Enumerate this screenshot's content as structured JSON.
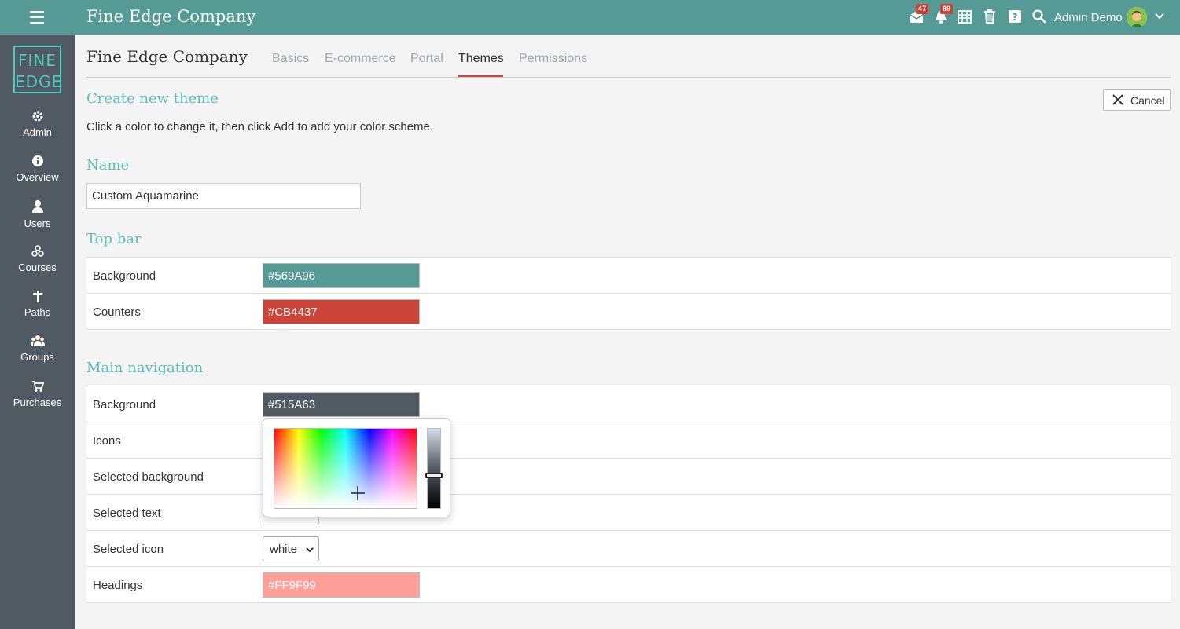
{
  "topbar": {
    "brand": "Fine Edge Company",
    "messages_count": "47",
    "notifications_count": "89",
    "user_name": "Admin Demo"
  },
  "sidebar": {
    "logo_line1": "FINE",
    "logo_line2": "EDGE",
    "items": [
      {
        "label": "Admin",
        "icon": "gear-icon"
      },
      {
        "label": "Overview",
        "icon": "info-icon"
      },
      {
        "label": "Users",
        "icon": "user-icon"
      },
      {
        "label": "Courses",
        "icon": "courses-icon"
      },
      {
        "label": "Paths",
        "icon": "signpost-icon"
      },
      {
        "label": "Groups",
        "icon": "group-icon"
      },
      {
        "label": "Purchases",
        "icon": "cart-icon"
      }
    ]
  },
  "page": {
    "title": "Fine Edge Company",
    "tabs": [
      {
        "label": "Basics"
      },
      {
        "label": "E-commerce"
      },
      {
        "label": "Portal"
      },
      {
        "label": "Themes",
        "active": true
      },
      {
        "label": "Permissions"
      }
    ]
  },
  "form": {
    "heading": "Create new theme",
    "description": "Click a color to change it, then click Add to add your color scheme.",
    "cancel_label": "Cancel",
    "name_heading": "Name",
    "name_value": "Custom Aquamarine",
    "top_bar": {
      "heading": "Top bar",
      "rows": [
        {
          "label": "Background",
          "value": "#569A96",
          "color": "#569A96"
        },
        {
          "label": "Counters",
          "value": "#CB4437",
          "color": "#CB4437"
        }
      ]
    },
    "main_nav": {
      "heading": "Main navigation",
      "rows": [
        {
          "label": "Background",
          "value": "#515A63",
          "color": "#515A63"
        },
        {
          "label": "Icons"
        },
        {
          "label": "Selected background"
        },
        {
          "label": "Selected text"
        },
        {
          "label": "Selected icon",
          "select_value": "white"
        },
        {
          "label": "Headings",
          "value": "#FF9F99",
          "color": "#FF9F99"
        }
      ]
    }
  },
  "colors": {
    "topbar": "#569A96",
    "sidebar": "#515A63",
    "accent_heading": "#5BBFB7",
    "badge": "#CB4437"
  }
}
